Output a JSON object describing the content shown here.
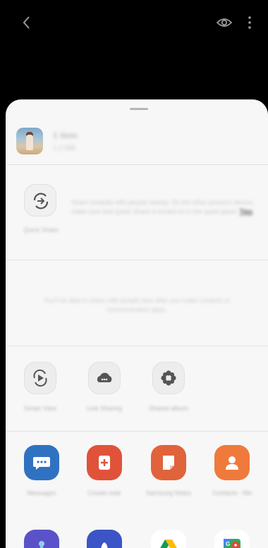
{
  "topbar": {
    "back_icon": "chevron-left-icon",
    "eye_icon": "eye-icon",
    "more_icon": "more-vertical-icon"
  },
  "share_header": {
    "title": "1 item",
    "subtitle": "1.2 MB"
  },
  "quick_share": {
    "label": "Quick Share",
    "description": "Share instantly with people nearby. On the other person's device, make sure that Quick Share is turned on in the quick panel.",
    "link": "Tips"
  },
  "contacts_info": "You'll be able to share with people here after you make contacts or communication apps.",
  "share_options": [
    {
      "label": "Smart View",
      "icon": "smart-view-icon"
    },
    {
      "label": "Link Sharing",
      "icon": "link-sharing-icon"
    },
    {
      "label": "Shared album",
      "icon": "shared-album-icon"
    }
  ],
  "apps": [
    {
      "label": "Messages",
      "icon": "messages-icon",
      "color": "#2f72c2"
    },
    {
      "label": "Create note",
      "icon": "create-note-icon",
      "color": "#e0533a"
    },
    {
      "label": "Samsung Notes",
      "icon": "samsung-notes-icon",
      "color": "#e0633c"
    },
    {
      "label": "Contacts - Me",
      "icon": "contacts-icon",
      "color": "#ef7a3c"
    }
  ],
  "apps_row2": [
    {
      "icon": "app-icon-purple",
      "color": "#5b52c9"
    },
    {
      "icon": "app-icon-blue",
      "color": "#3b55c6"
    },
    {
      "icon": "google-drive-icon",
      "color": "#ffffff"
    },
    {
      "icon": "google-maps-icon",
      "color": "#ffffff"
    }
  ]
}
